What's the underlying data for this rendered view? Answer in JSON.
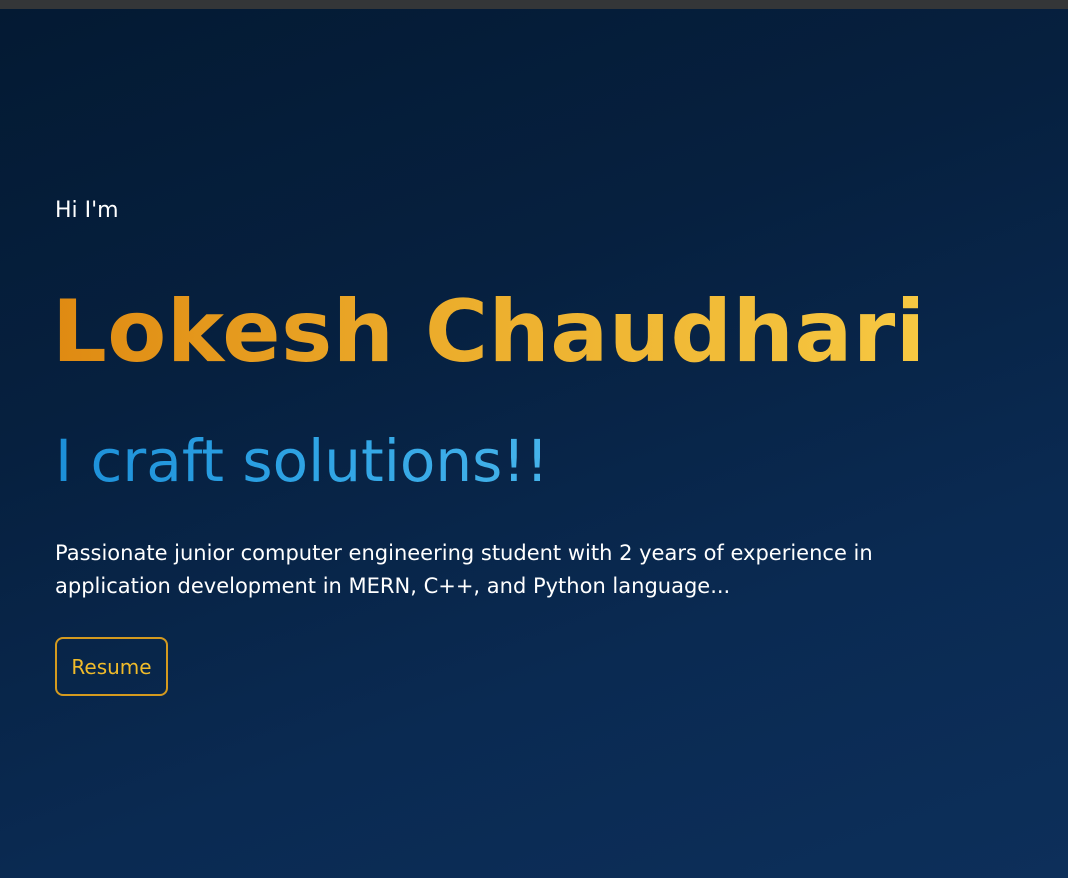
{
  "hero": {
    "greeting": "Hi I'm",
    "name": "Lokesh Chaudhari",
    "tagline": "I craft solutions!!",
    "description": "Passionate junior computer engineering student with 2 years of experience in application development in MERN, C++, and Python language...",
    "resume_label": "Resume"
  },
  "colors": {
    "background_dark": "#041a33",
    "background_light": "#0d2f5a",
    "name_gradient_start": "#df8a12",
    "name_gradient_end": "#f6c842",
    "tagline_blue": "#2ea3e4",
    "button_accent": "#d49a1f",
    "text": "#ffffff"
  }
}
